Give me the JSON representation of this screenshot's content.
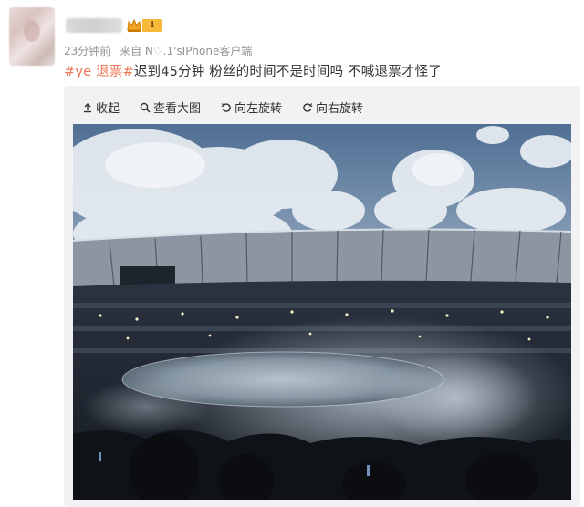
{
  "header": {
    "level_badge": "1",
    "time_ago": "23分钟前",
    "source_prefix": "来自 N♡.1'sIPhone客户端",
    "source_suffix": ""
  },
  "post": {
    "tag1": "#ye",
    "tag2": "退票#",
    "text": "迟到45分钟 粉丝的时间不是时间吗 不喊退票才怪了"
  },
  "toolbar": {
    "collapse": "收起",
    "view_large": "查看大图",
    "rotate_left": "向左旋转",
    "rotate_right": "向右旋转"
  },
  "colors": {
    "tag": "#eb7350",
    "badge": "#f8b93a",
    "meta": "#939393"
  }
}
